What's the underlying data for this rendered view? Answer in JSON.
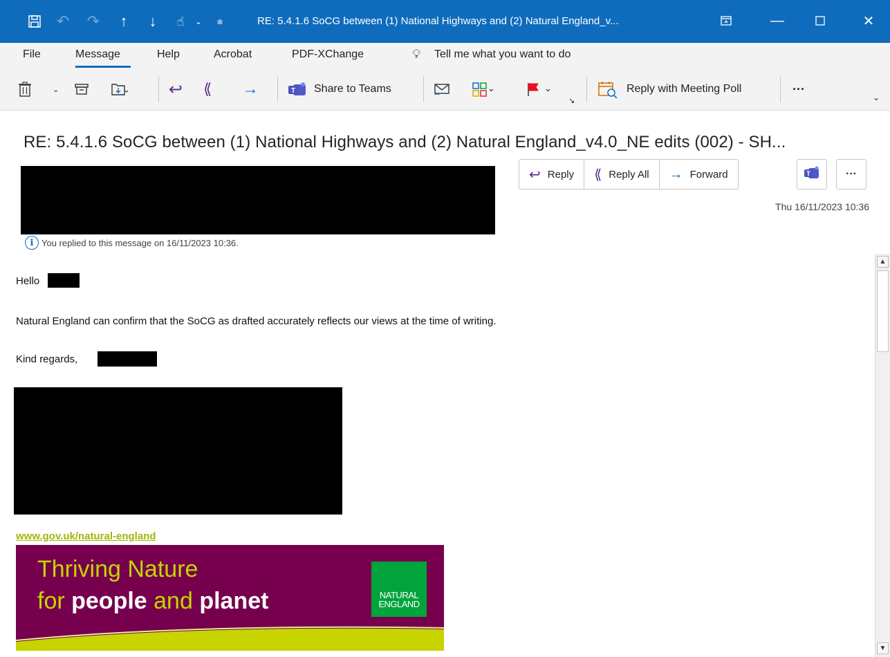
{
  "titlebar": {
    "title": "RE: 5.4.1.6 SoCG between (1) National Highways and (2) Natural England_v...",
    "icons": [
      "save-icon",
      "undo-icon",
      "redo-icon",
      "up-arrow-icon",
      "down-arrow-icon",
      "touch-mode-icon",
      "customize-qat-icon",
      "restore-window-icon",
      "minimize-icon",
      "maximize-icon",
      "close-icon"
    ]
  },
  "menu": {
    "items": [
      "File",
      "Message",
      "Help",
      "Acrobat",
      "PDF-XChange"
    ],
    "tell_me": "Tell me what you want to do",
    "active": "Message"
  },
  "ribbon": {
    "share_to_teams": "Share to Teams",
    "reply_with_meeting_poll": "Reply with Meeting Poll",
    "more": "···"
  },
  "email": {
    "subject": "RE: 5.4.1.6 SoCG between (1) National Highways and (2) Natural England_v4.0_NE edits (002) - SH...",
    "date": "Thu 16/11/2023 10:36",
    "replied_info": "You replied to this message on 16/11/2023 10:36.",
    "actions": {
      "reply": "Reply",
      "reply_all": "Reply All",
      "forward": "Forward",
      "more": "···"
    }
  },
  "body": {
    "greeting": "Hello",
    "line1": "Natural England can confirm that the SoCG as drafted accurately reflects our views at the time of writing.",
    "signoff": "Kind regards,",
    "link": "www.gov.uk/natural-england"
  },
  "banner": {
    "line1": "Thriving Nature",
    "line2_pre": "for ",
    "line2_b1": "people",
    "line2_mid": " and ",
    "line2_b2": "planet",
    "logo_line1": "NATURAL",
    "logo_line2": "ENGLAND"
  },
  "colors": {
    "titlebar": "#0f6cbd",
    "ribbon_bg": "#f3f3f3",
    "reply_purple": "#5c2e91",
    "banner_bg": "#76004d",
    "banner_text": "#c7d400",
    "logo_green": "#00a33c",
    "link": "#a3b50b"
  }
}
